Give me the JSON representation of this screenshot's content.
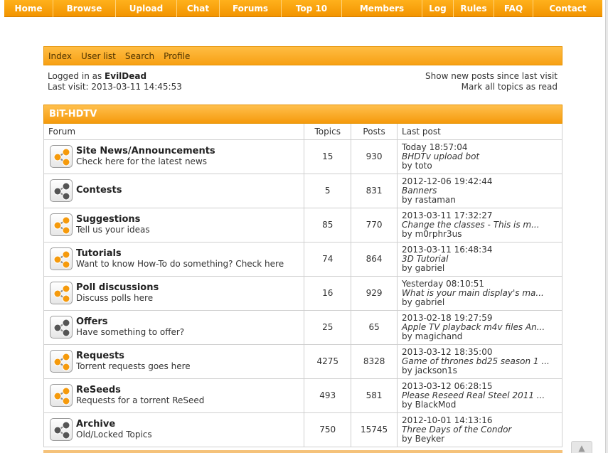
{
  "topnav": [
    {
      "label": "Home",
      "w": 69
    },
    {
      "label": "Browse",
      "w": 88
    },
    {
      "label": "Upload",
      "w": 86
    },
    {
      "label": "Chat",
      "w": 60
    },
    {
      "label": "Forums",
      "w": 87
    },
    {
      "label": "Top 10",
      "w": 85
    },
    {
      "label": "Members",
      "w": 113
    },
    {
      "label": "Log",
      "w": 44
    },
    {
      "label": "Rules",
      "w": 57
    },
    {
      "label": "FAQ",
      "w": 55
    },
    {
      "label": "Contact",
      "w": 97
    }
  ],
  "subnav": [
    "Index",
    "User list",
    "Search",
    "Profile"
  ],
  "login": {
    "logged_in_prefix": "Logged in as ",
    "username": "EvilDead",
    "last_visit": "Last visit: 2013-03-11 14:45:53",
    "show_new": "Show new posts since last visit",
    "mark_read": "Mark all topics as read"
  },
  "category": "BiT-HDTV",
  "table_headers": {
    "forum": "Forum",
    "topics": "Topics",
    "posts": "Posts",
    "last_post": "Last post"
  },
  "forums": [
    {
      "name": "Site News/Announcements",
      "desc": "Check here for the latest news",
      "topics": "15",
      "posts": "930",
      "lp_date": "Today 18:57:04",
      "lp_topic": "BHDTv upload bot",
      "lp_by": "by ",
      "lp_user": "toto",
      "new": true
    },
    {
      "name": "Contests",
      "desc": "",
      "topics": "5",
      "posts": "831",
      "lp_date": "2012-12-06 19:42:44",
      "lp_topic": "Banners",
      "lp_by": "by ",
      "lp_user": "rastaman",
      "new": false
    },
    {
      "name": "Suggestions",
      "desc": "Tell us your ideas",
      "topics": "85",
      "posts": "770",
      "lp_date": "2013-03-11 17:32:27",
      "lp_topic": "Change the classes - This is m...",
      "lp_by": "by ",
      "lp_user": "m0rphr3us",
      "new": true
    },
    {
      "name": "Tutorials",
      "desc": "Want to know How-To do something? Check here",
      "topics": "74",
      "posts": "864",
      "lp_date": "2013-03-11 16:48:34",
      "lp_topic": "3D Tutorial",
      "lp_by": "by ",
      "lp_user": "gabriel",
      "new": true
    },
    {
      "name": "Poll discussions",
      "desc": "Discuss polls here",
      "topics": "16",
      "posts": "929",
      "lp_date": "Yesterday 08:10:51",
      "lp_topic": "What is your main display's ma...",
      "lp_by": "by ",
      "lp_user": "gabriel",
      "new": true
    },
    {
      "name": "Offers",
      "desc": "Have something to offer?",
      "topics": "25",
      "posts": "65",
      "lp_date": "2013-02-18 19:27:59",
      "lp_topic": "Apple TV playback m4v files An...",
      "lp_by": "by ",
      "lp_user": "magichand",
      "new": false
    },
    {
      "name": "Requests",
      "desc": "Torrent requests goes here",
      "topics": "4275",
      "posts": "8328",
      "lp_date": "2013-03-12 18:35:00",
      "lp_topic": "Game of thrones bd25 season 1 ...",
      "lp_by": "by ",
      "lp_user": "jackson1s",
      "new": true
    },
    {
      "name": "ReSeeds",
      "desc": "Requests for a torrent ReSeed",
      "topics": "493",
      "posts": "581",
      "lp_date": "2013-03-12 06:28:15",
      "lp_topic": "Please Reseed Real Steel 2011 ...",
      "lp_by": "by ",
      "lp_user": "BlackMod",
      "new": true
    },
    {
      "name": "Archive",
      "desc": "Old/Locked Topics",
      "topics": "750",
      "posts": "15745",
      "lp_date": "2012-10-01 14:13:16",
      "lp_topic": "Three Days of the Condor",
      "lp_by": "by ",
      "lp_user": "Beyker",
      "new": false
    }
  ],
  "colors": {
    "orange": "#f7a014",
    "orange_light": "#ffc04d",
    "icon_new_node": "#f59a0c",
    "icon_old_node": "#555555",
    "border": "#cfcfcf"
  },
  "icons": {
    "forum_new": "forum-new-posts-icon",
    "forum_old": "forum-no-new-posts-icon",
    "scroll": "scroll-up-icon"
  },
  "scroll_label": "▲"
}
